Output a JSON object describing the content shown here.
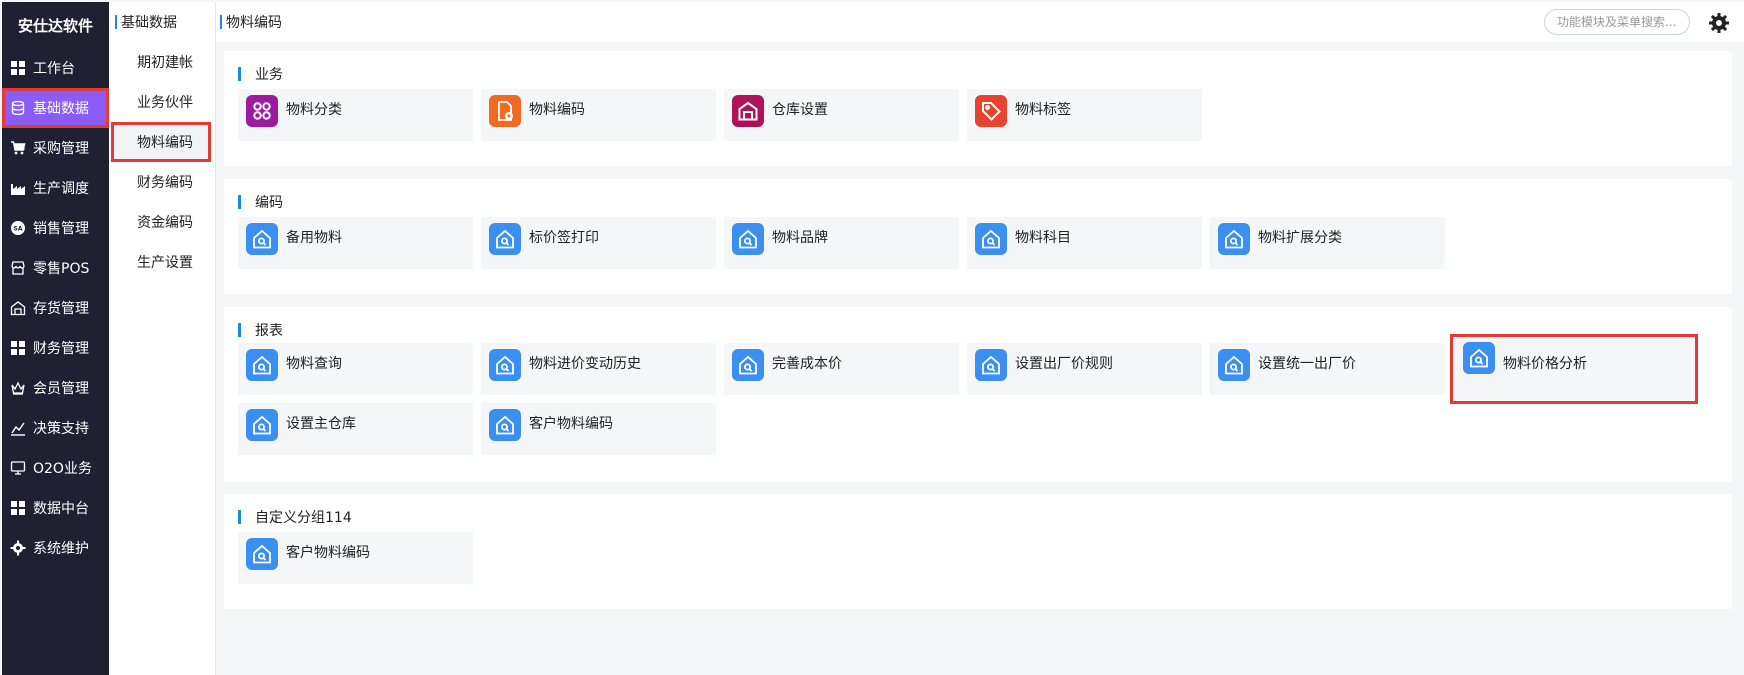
{
  "app": {
    "brand": "安仕达软件"
  },
  "sidebar": {
    "items": [
      {
        "label": "工作台",
        "icon": "grid-icon",
        "active": false
      },
      {
        "label": "基础数据",
        "icon": "database-icon",
        "active": true
      },
      {
        "label": "采购管理",
        "icon": "cart-icon",
        "active": false
      },
      {
        "label": "生产调度",
        "icon": "factory-icon",
        "active": false
      },
      {
        "label": "销售管理",
        "icon": "sale-icon",
        "active": false
      },
      {
        "label": "零售POS",
        "icon": "store-icon",
        "active": false
      },
      {
        "label": "存货管理",
        "icon": "warehouse-icon",
        "active": false
      },
      {
        "label": "财务管理",
        "icon": "grid-icon",
        "active": false
      },
      {
        "label": "会员管理",
        "icon": "crown-icon",
        "active": false
      },
      {
        "label": "决策支持",
        "icon": "chart-icon",
        "active": false
      },
      {
        "label": "O2O业务",
        "icon": "monitor-icon",
        "active": false
      },
      {
        "label": "数据中台",
        "icon": "grid-icon",
        "active": false
      },
      {
        "label": "系统维护",
        "icon": "gear-icon",
        "active": false
      }
    ]
  },
  "subpanel": {
    "title": "基础数据",
    "items": [
      {
        "label": "期初建帐",
        "active": false
      },
      {
        "label": "业务伙伴",
        "active": false
      },
      {
        "label": "物料编码",
        "active": true
      },
      {
        "label": "财务编码",
        "active": false
      },
      {
        "label": "资金编码",
        "active": false
      },
      {
        "label": "生产设置",
        "active": false
      }
    ]
  },
  "topbar": {
    "breadcrumb": "物料编码",
    "search_placeholder": "功能模块及菜单搜索..."
  },
  "groups": [
    {
      "title": "业务",
      "tiles": [
        {
          "label": "物料分类",
          "icon": "category-icon",
          "color": "#9c1ba0"
        },
        {
          "label": "物料编码",
          "icon": "file-gear-icon",
          "color": "#f26a21"
        },
        {
          "label": "仓库设置",
          "icon": "warehouse-icon",
          "color": "#b0125a"
        },
        {
          "label": "物料标签",
          "icon": "tag-icon",
          "color": "#e8432e"
        }
      ]
    },
    {
      "title": "编码",
      "tiles": [
        {
          "label": "备用物料",
          "icon": "house-search-icon",
          "color": "#3b8ff0"
        },
        {
          "label": "标价签打印",
          "icon": "house-search-icon",
          "color": "#3b8ff0"
        },
        {
          "label": "物料品牌",
          "icon": "house-search-icon",
          "color": "#3b8ff0"
        },
        {
          "label": "物料科目",
          "icon": "house-search-icon",
          "color": "#3b8ff0"
        },
        {
          "label": "物料扩展分类",
          "icon": "house-search-icon",
          "color": "#3b8ff0"
        }
      ]
    },
    {
      "title": "报表",
      "tiles": [
        {
          "label": "物料查询",
          "icon": "house-search-icon",
          "color": "#3b8ff0"
        },
        {
          "label": "物料进价变动历史",
          "icon": "house-search-icon",
          "color": "#3b8ff0"
        },
        {
          "label": "完善成本价",
          "icon": "house-search-icon",
          "color": "#3b8ff0"
        },
        {
          "label": "设置出厂价规则",
          "icon": "house-search-icon",
          "color": "#3b8ff0"
        },
        {
          "label": "设置统一出厂价",
          "icon": "house-search-icon",
          "color": "#3b8ff0"
        },
        {
          "label": "物料价格分析",
          "icon": "house-search-icon",
          "color": "#3b8ff0",
          "highlighted": true
        },
        {
          "label": "设置主仓库",
          "icon": "house-search-icon",
          "color": "#3b8ff0"
        },
        {
          "label": "客户物料编码",
          "icon": "house-search-icon",
          "color": "#3b8ff0"
        }
      ]
    },
    {
      "title": "自定义分组114",
      "tiles": [
        {
          "label": "客户物料编码",
          "icon": "house-search-icon",
          "color": "#3b8ff0"
        }
      ]
    }
  ]
}
